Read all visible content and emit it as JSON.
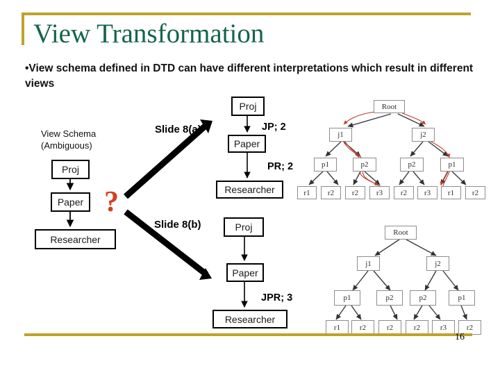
{
  "slide": {
    "title": "View Transformation",
    "bullet": "•View schema defined in DTD can have different interpretations which result in different views",
    "page_number": "16",
    "accent_gold": "#c0a22c",
    "title_green": "#14654a",
    "question_red": "#d4401f",
    "tree_link_red": "#c0392b"
  },
  "source_schema": {
    "caption_line1": "View Schema",
    "caption_line2": "(Ambiguous)",
    "nodes": [
      "Proj",
      "Paper",
      "Researcher"
    ],
    "question_mark": "?"
  },
  "transitions": [
    {
      "label": "Slide 8(a)"
    },
    {
      "label": "Slide 8(b)"
    }
  ],
  "interpretation_a": {
    "nodes": [
      "Proj",
      "Paper",
      "Researcher"
    ],
    "edge_labels": [
      "JP; 2",
      "PR; 2"
    ]
  },
  "interpretation_b": {
    "nodes": [
      "Proj",
      "Paper",
      "Researcher"
    ],
    "edge_labels": [
      "JPR; 3"
    ]
  },
  "tree_top": {
    "root": "Root",
    "level2": [
      "j1",
      "j2"
    ],
    "level3": [
      "p1",
      "p2",
      "p2",
      "p1"
    ],
    "leaves": [
      "r1",
      "r2",
      "r2",
      "r3",
      "r2",
      "r3",
      "r1",
      "r2"
    ],
    "highlighted_path": [
      "Root",
      "j1",
      "p2",
      "r3",
      "j2",
      "p1",
      "r1"
    ]
  },
  "tree_bottom": {
    "root": "Root",
    "level2": [
      "j1",
      "j2"
    ],
    "level3": [
      "p1",
      "p2",
      "p2",
      "p1"
    ],
    "leaves": [
      "r1",
      "r2",
      "r2",
      "r2",
      "r3",
      "r2"
    ]
  }
}
